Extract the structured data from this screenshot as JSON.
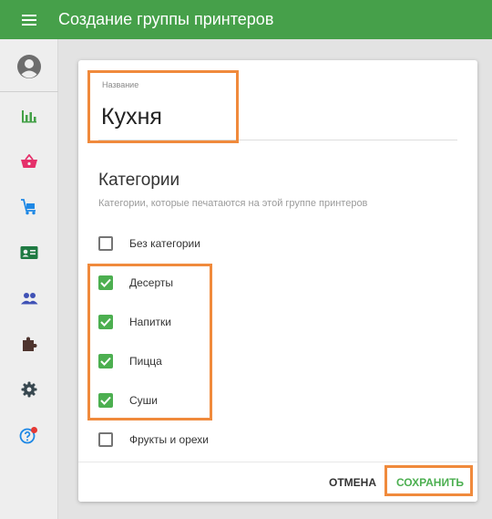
{
  "app": {
    "title": "Создание группы принтеров"
  },
  "topbar": {
    "menu_icon": "hamburger-menu-icon",
    "color": "#46a04a"
  },
  "sidebar": {
    "items": [
      {
        "icon": "account-circle-icon"
      },
      {
        "icon": "bar-chart-icon"
      },
      {
        "icon": "shopping-basket-icon"
      },
      {
        "icon": "cart-icon"
      },
      {
        "icon": "contact-card-icon"
      },
      {
        "icon": "people-icon"
      },
      {
        "icon": "puzzle-icon"
      },
      {
        "icon": "gear-icon"
      },
      {
        "icon": "help-icon"
      }
    ]
  },
  "form": {
    "name_label": "Название",
    "name_value": "Кухня",
    "categories_title": "Категории",
    "categories_subtitle": "Категории, которые печатаются на этой группе принтеров",
    "categories": [
      {
        "label": "Без категории",
        "checked": false
      },
      {
        "label": "Десерты",
        "checked": true
      },
      {
        "label": "Напитки",
        "checked": true
      },
      {
        "label": "Пицца",
        "checked": true
      },
      {
        "label": "Суши",
        "checked": true
      },
      {
        "label": "Фрукты и орехи",
        "checked": false
      }
    ]
  },
  "footer": {
    "cancel_label": "ОТМЕНА",
    "save_label": "СОХРАНИТЬ"
  },
  "colors": {
    "accent": "#4caf50",
    "highlight": "#f08a3c"
  }
}
